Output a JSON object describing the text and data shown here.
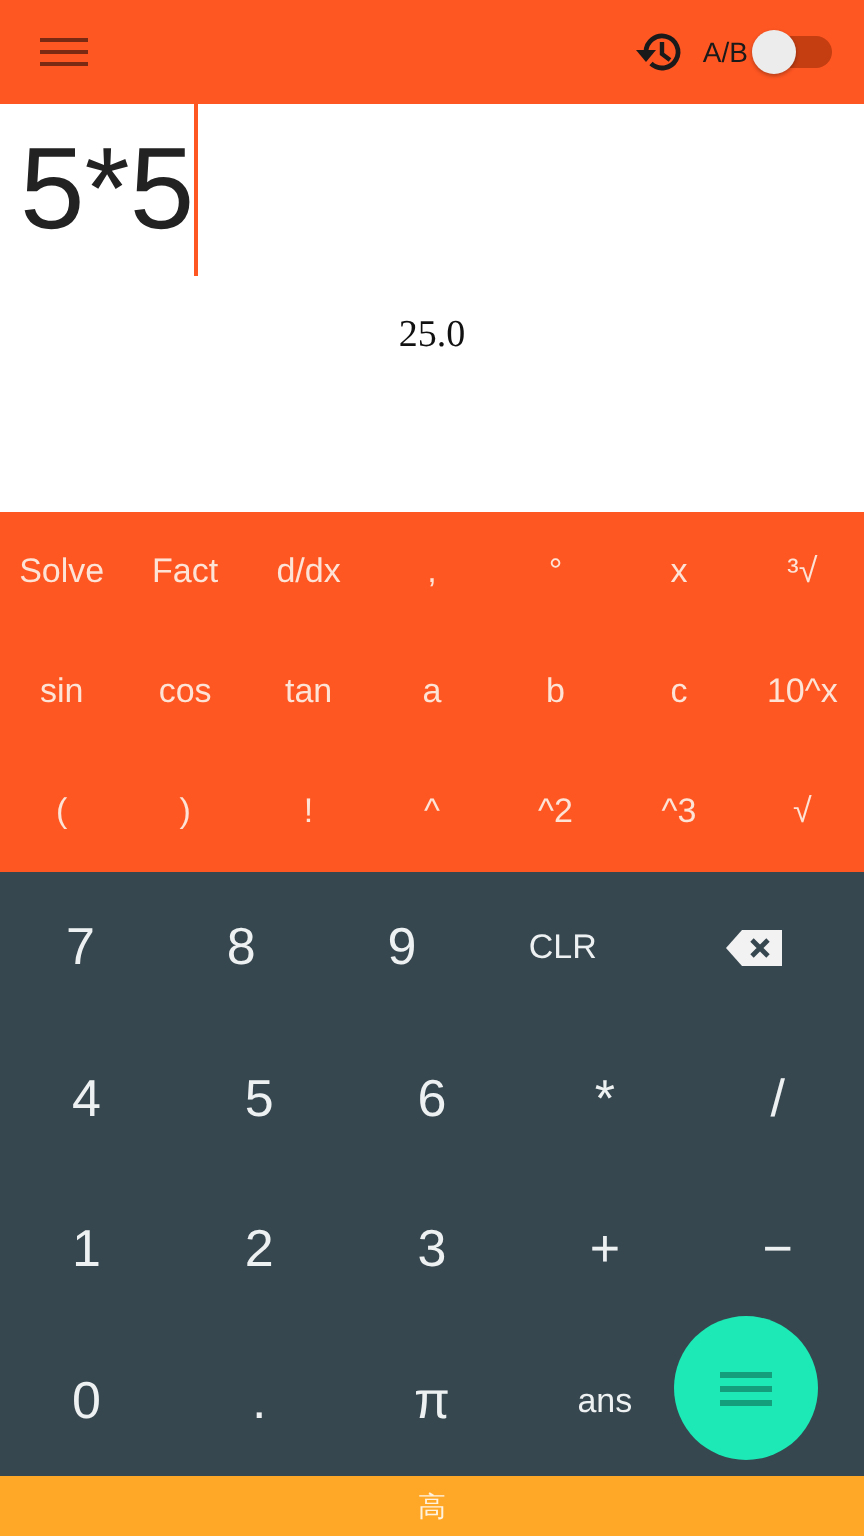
{
  "toolbar": {
    "switch": {
      "label": "A/B",
      "on": false
    }
  },
  "display": {
    "expression": "5*5",
    "result": "25.0"
  },
  "scientific_keys": [
    [
      "Solve",
      "Fact",
      "d/dx",
      ",",
      "°",
      "x",
      "³√"
    ],
    [
      "sin",
      "cos",
      "tan",
      "a",
      "b",
      "c",
      "10^x"
    ],
    [
      "(",
      ")",
      "!",
      "^",
      "^2",
      "^3",
      "√"
    ]
  ],
  "number_keys": [
    [
      {
        "kind": "text",
        "label": "7"
      },
      {
        "kind": "text",
        "label": "8"
      },
      {
        "kind": "text",
        "label": "9"
      },
      {
        "kind": "text",
        "label": "CLR"
      },
      {
        "kind": "backspace"
      }
    ],
    [
      {
        "kind": "text",
        "label": "4"
      },
      {
        "kind": "text",
        "label": "5"
      },
      {
        "kind": "text",
        "label": "6"
      },
      {
        "kind": "text",
        "label": "*"
      },
      {
        "kind": "text",
        "label": "/"
      }
    ],
    [
      {
        "kind": "text",
        "label": "1"
      },
      {
        "kind": "text",
        "label": "2"
      },
      {
        "kind": "text",
        "label": "3"
      },
      {
        "kind": "text",
        "label": "+"
      },
      {
        "kind": "text",
        "label": "−"
      }
    ],
    [
      {
        "kind": "text",
        "label": "0"
      },
      {
        "kind": "text",
        "label": "."
      },
      {
        "kind": "text",
        "label": "π"
      },
      {
        "kind": "text",
        "label": "ans"
      },
      {
        "kind": "fab"
      }
    ]
  ],
  "bottom_bar": {
    "label": "高"
  }
}
